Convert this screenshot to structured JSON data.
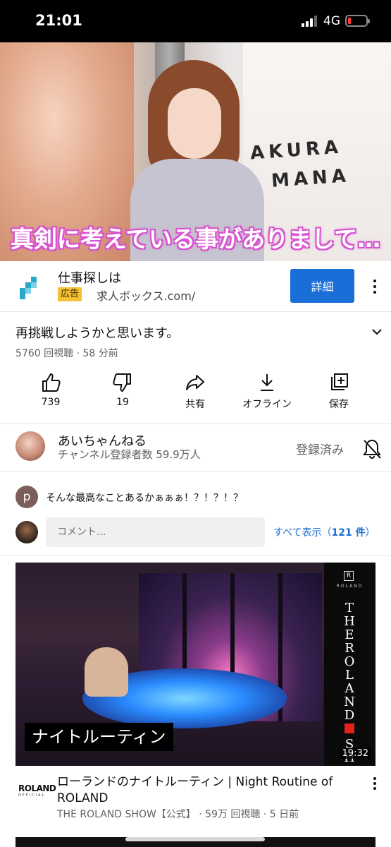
{
  "status_bar": {
    "time": "21:01",
    "network": "4G",
    "battery_color": "#ff3b30"
  },
  "video": {
    "caption": "真剣に考えている事がありまして…",
    "poster_text_1": "AKURA",
    "poster_text_2": "MANA"
  },
  "ad": {
    "title": "仕事探しは",
    "badge": "広告",
    "domain": "求人ボックス.com/",
    "button": "詳細",
    "button_color": "#1a6ed8"
  },
  "video_info": {
    "title": "再挑戦しようかと思います。",
    "meta": "5760 回視聴 · 58 分前"
  },
  "actions": [
    {
      "icon": "like-icon",
      "label": "739"
    },
    {
      "icon": "dislike-icon",
      "label": "19"
    },
    {
      "icon": "share-icon",
      "label": "共有"
    },
    {
      "icon": "download-icon",
      "label": "オフライン"
    },
    {
      "icon": "save-icon",
      "label": "保存"
    }
  ],
  "channel": {
    "name": "あいちゃんねる",
    "subscribers": "チャンネル登録者数 59.9万人",
    "subscribed_label": "登録済み"
  },
  "comments": {
    "avatar_letter": "p",
    "top_comment": "そんな最高なことあるかぁぁぁ！？！？！？",
    "placeholder": "コメント...",
    "show_all_prefix": "すべて表示（",
    "show_all_count": "121 件",
    "show_all_suffix": "）"
  },
  "recommendation": {
    "thumbnail_caption": "ナイトルーティン",
    "duration": "19:32",
    "banner_logo": "R",
    "banner_sub": "ROLAND",
    "banner_text_1": "THE ROLAND",
    "banner_text_2": "SHO",
    "channel_logo": "ROLAND",
    "channel_logo_sub": "OFFICIAL",
    "title": "ローランドのナイトルーティン | Night Routine of ROLAND",
    "meta": "THE ROLAND SHOW【公式】 · 59万 回視聴 · 5 日前"
  }
}
